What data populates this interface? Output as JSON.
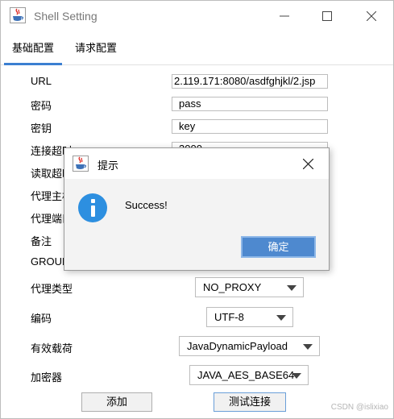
{
  "window": {
    "title": "Shell Setting",
    "icon": "java-cup-icon",
    "controls": {
      "minimize": "—",
      "maximize": "☐",
      "close": "✕"
    }
  },
  "tabs": [
    {
      "label": "基础配置",
      "active": true
    },
    {
      "label": "请求配置",
      "active": false
    }
  ],
  "form": {
    "url_label": "URL",
    "url_value": "2.119.171:8080/asdfghjkl/2.jsp",
    "password_label": "密码",
    "password_value": "pass",
    "key_label": "密钥",
    "key_value": "key",
    "connect_timeout_label": "连接超时",
    "connect_timeout_value": "3000",
    "read_timeout_label": "读取超时",
    "proxy_host_label": "代理主机",
    "proxy_port_label": "代理端口",
    "remark_label": "备注",
    "group_label": "GROUP",
    "proxy_type_label": "代理类型",
    "proxy_type_value": "NO_PROXY",
    "encoding_label": "编码",
    "encoding_value": "UTF-8",
    "payload_label": "有效载荷",
    "payload_value": "JavaDynamicPayload",
    "cryption_label": "加密器",
    "cryption_value": "JAVA_AES_BASE64"
  },
  "buttons": {
    "add": "添加",
    "test": "测试连接"
  },
  "dialog": {
    "title": "提示",
    "message": "Success!",
    "ok": "确定",
    "close": "✕"
  },
  "watermark": "CSDN @islixiao",
  "colors": {
    "tab_underline": "#3b7fd1",
    "info_icon": "#2d8fe0",
    "ok_button": "#4e89cf"
  }
}
